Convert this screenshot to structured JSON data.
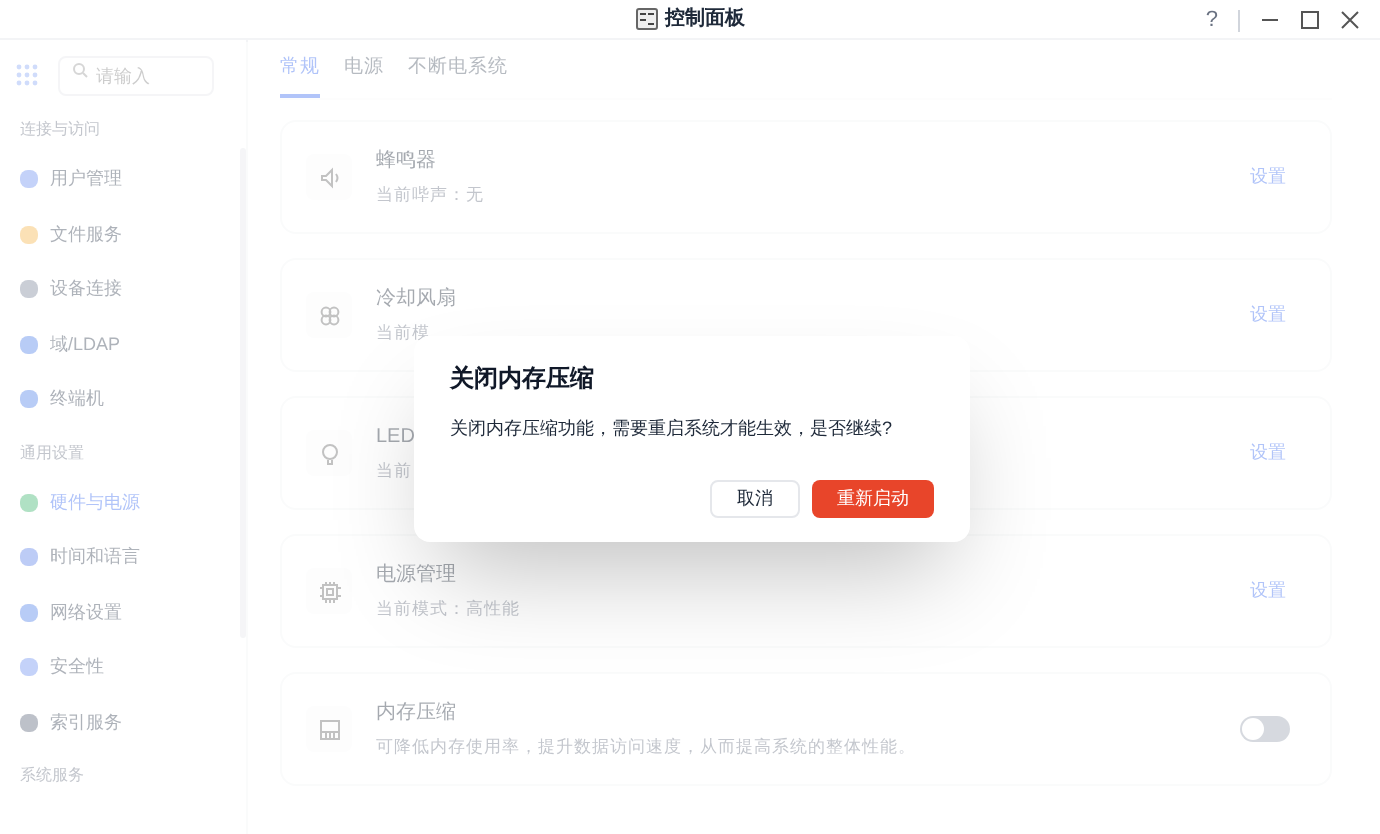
{
  "window": {
    "title": "控制面板",
    "help": "?"
  },
  "search": {
    "placeholder": "请输入"
  },
  "sidebar": {
    "sections": [
      {
        "title": "连接与访问",
        "items": [
          {
            "label": "用户管理",
            "selected": false
          },
          {
            "label": "文件服务",
            "selected": false
          },
          {
            "label": "设备连接",
            "selected": false
          },
          {
            "label": "域/LDAP",
            "selected": false
          },
          {
            "label": "终端机",
            "selected": false
          }
        ]
      },
      {
        "title": "通用设置",
        "items": [
          {
            "label": "硬件与电源",
            "selected": true
          },
          {
            "label": "时间和语言",
            "selected": false
          },
          {
            "label": "网络设置",
            "selected": false
          },
          {
            "label": "安全性",
            "selected": false
          },
          {
            "label": "索引服务",
            "selected": false
          }
        ]
      },
      {
        "title": "系统服务"
      }
    ]
  },
  "tabs": [
    {
      "label": "常规",
      "selected": true
    },
    {
      "label": "电源",
      "selected": false
    },
    {
      "label": "不断电系统",
      "selected": false
    }
  ],
  "cards": [
    {
      "kind": "link",
      "title": "蜂鸣器",
      "subtitle": "当前哔声：无",
      "action": "设置"
    },
    {
      "kind": "link",
      "title": "冷却风扇",
      "subtitle": "当前模",
      "action": "设置"
    },
    {
      "kind": "link",
      "title": "LED",
      "subtitle": "当前",
      "action": "设置"
    },
    {
      "kind": "link",
      "title": "电源管理",
      "subtitle": "当前模式：高性能",
      "action": "设置"
    },
    {
      "kind": "toggle",
      "title": "内存压缩",
      "subtitle": "可降低内存使用率，提升数据访问速度，从而提高系统的整体性能。",
      "on": false
    }
  ],
  "dialog": {
    "title": "关闭内存压缩",
    "message": "关闭内存压缩功能，需要重启系统才能生效，是否继续?",
    "buttons": [
      {
        "kind": "secondary",
        "label": "取消"
      },
      {
        "kind": "primary",
        "label": "重新启动"
      }
    ]
  }
}
